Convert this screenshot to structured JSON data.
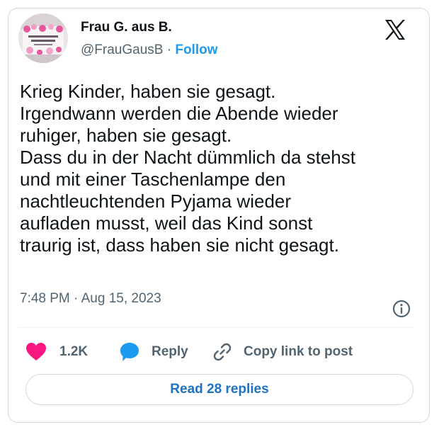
{
  "author": {
    "display_name": "Frau G. aus B.",
    "handle": "@FrauGausB",
    "separator": "·",
    "follow_label": "Follow"
  },
  "tweet": {
    "lines": [
      "Krieg Kinder, haben sie gesagt.",
      "Irgendwann werden die Abende wieder",
      "ruhiger, haben sie gesagt.",
      "Dass du in der Nacht dümmlich da stehst",
      "und mit einer Taschenlampe den",
      "nachtleuchtenden Pyjama wieder",
      "aufladen musst, weil das Kind sonst",
      "traurig ist, dass haben sie nicht gesagt."
    ],
    "time": "7:48 PM",
    "date_separator": "·",
    "date": "Aug 15, 2023"
  },
  "actions": {
    "like_count": "1.2K",
    "reply_label": "Reply",
    "copy_link_label": "Copy link to post"
  },
  "read_replies_label": "Read 28 replies",
  "icons": {
    "logo": "x-logo-icon",
    "info": "info-icon",
    "like": "heart-icon",
    "reply": "speech-bubble-icon",
    "copy": "link-icon"
  },
  "colors": {
    "accent": "#1d9bf0",
    "like": "#f91880",
    "text": "#0f1419",
    "muted": "#536471",
    "border": "#cfd9de"
  }
}
